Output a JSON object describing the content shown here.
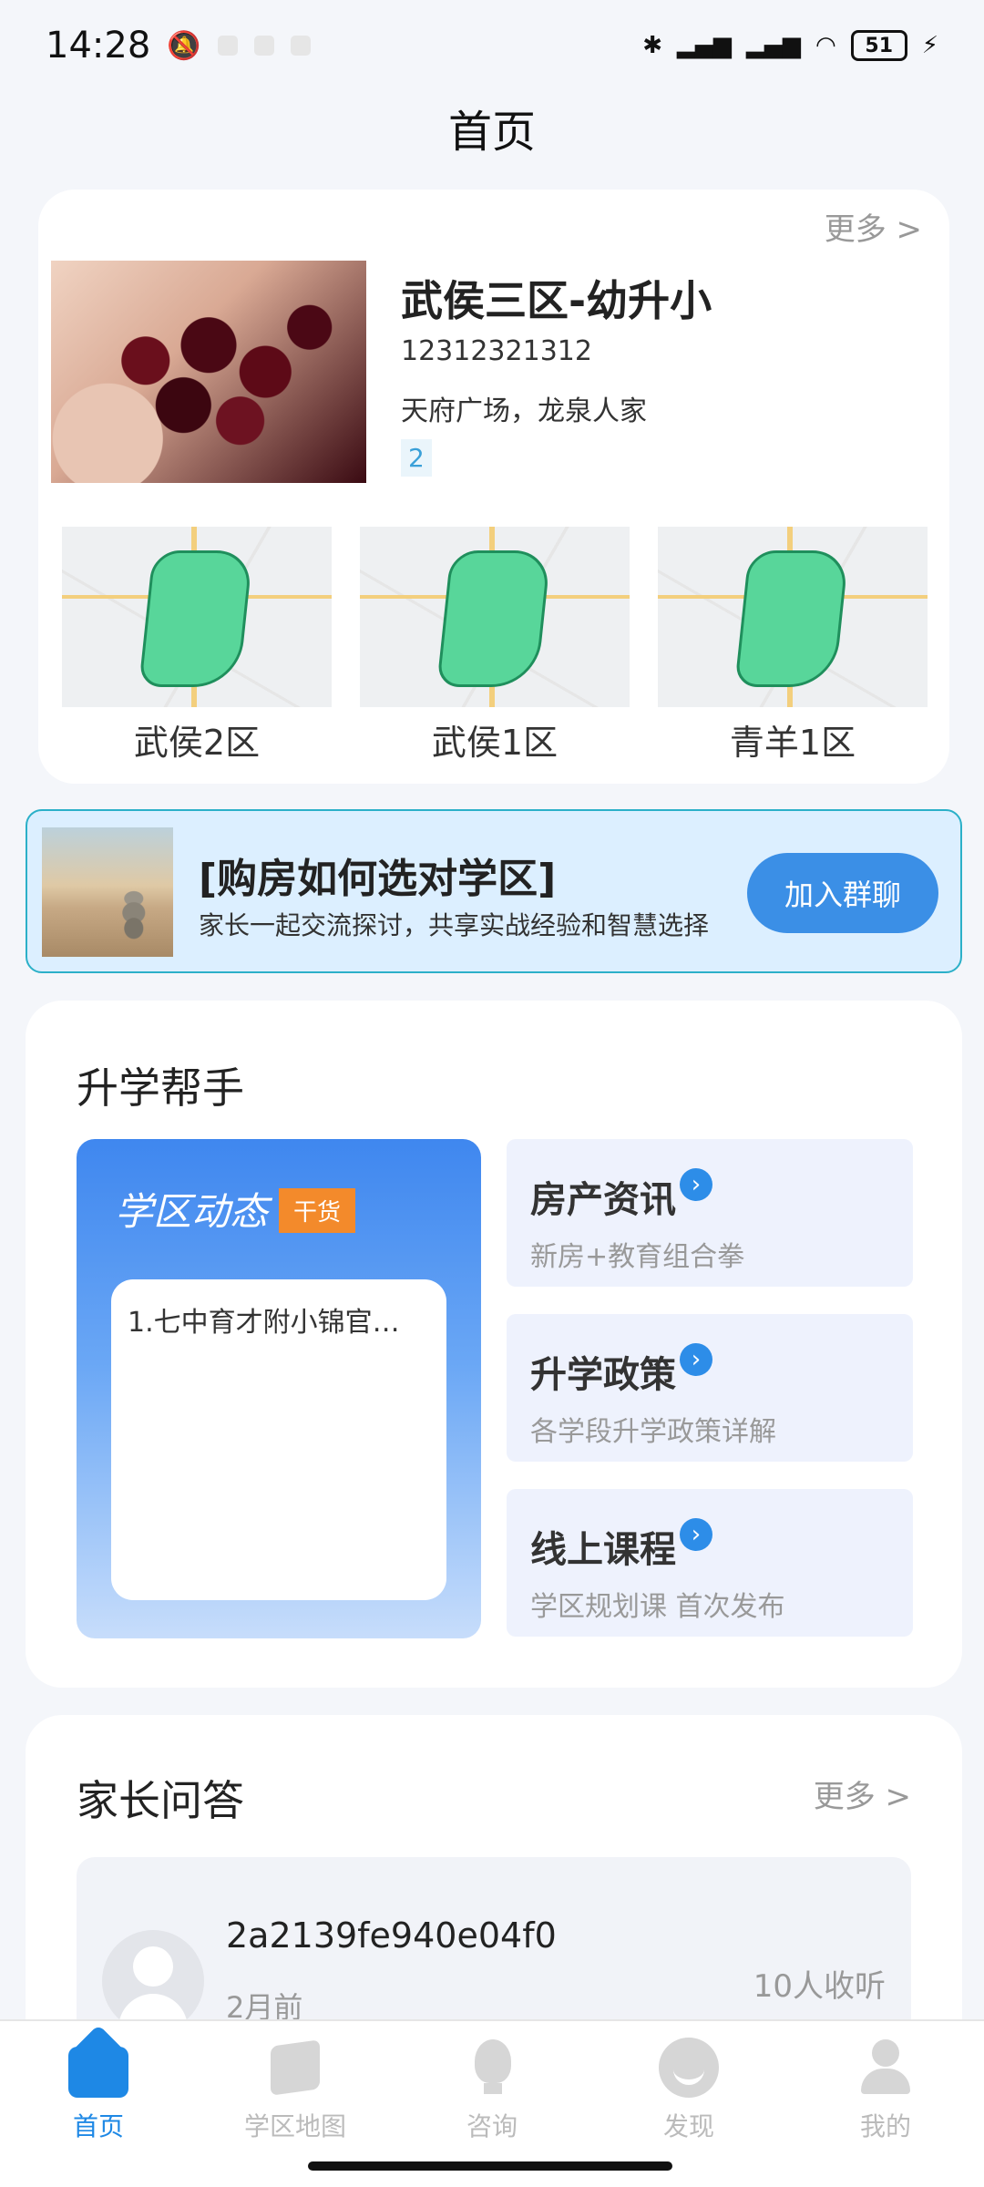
{
  "status_bar": {
    "time": "14:28",
    "battery": "51",
    "icons": [
      "mute-icon",
      "bluetooth-icon",
      "signal-hd-icon",
      "signal-hd-icon",
      "wifi-icon",
      "charging-icon"
    ]
  },
  "page_title": "首页",
  "school_card": {
    "more": "更多 >",
    "title": "武侯三区-幼升小",
    "phone": "12312321312",
    "address": "天府广场，龙泉人家",
    "tag": "2",
    "districts": [
      {
        "label": "武侯2区"
      },
      {
        "label": "武侯1区"
      },
      {
        "label": "青羊1区"
      }
    ]
  },
  "banner": {
    "title": "[购房如何选对学区]",
    "subtitle": "家长一起交流探讨，共享实战经验和智慧选择",
    "button": "加入群聊"
  },
  "helper": {
    "title": "升学帮手",
    "dynamic": {
      "title": "学区动态",
      "tag": "干货",
      "first_item": "1.七中育才附小锦官…"
    },
    "items": [
      {
        "title": "房产资讯",
        "subtitle": "新房+教育组合拳"
      },
      {
        "title": "升学政策",
        "subtitle": "各学段升学政策详解"
      },
      {
        "title": "线上课程",
        "subtitle": "学区规划课 首次发布"
      }
    ]
  },
  "qa": {
    "title": "家长问答",
    "more": "更多 >",
    "items": [
      {
        "user": "2a2139fe940e04f0",
        "time": "2月前",
        "listeners": "10人收听"
      }
    ]
  },
  "nav": [
    {
      "label": "首页",
      "icon": "home-icon",
      "active": true
    },
    {
      "label": "学区地图",
      "icon": "map-icon",
      "active": false
    },
    {
      "label": "咨询",
      "icon": "bulb-icon",
      "active": false
    },
    {
      "label": "发现",
      "icon": "discover-icon",
      "active": false
    },
    {
      "label": "我的",
      "icon": "user-icon",
      "active": false
    }
  ],
  "colors": {
    "accent": "#1e88e5",
    "banner_bg": "#dcefff",
    "tag_orange": "#f38a2b"
  }
}
